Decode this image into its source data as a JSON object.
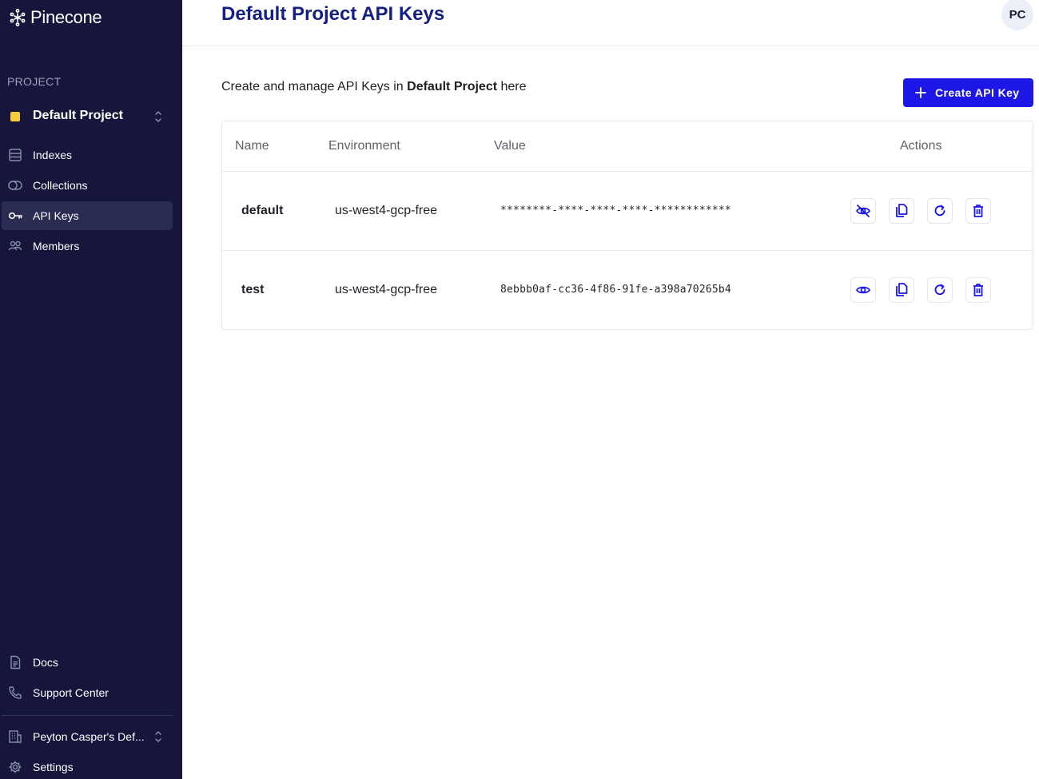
{
  "app": {
    "brand": "Pinecone",
    "brand_icon": "pinecone-logo-icon"
  },
  "sidebar": {
    "section_label": "PROJECT",
    "project": {
      "name": "Default Project",
      "color": "#f5cd3b"
    },
    "nav": [
      {
        "label": "Indexes",
        "icon": "indexes-icon",
        "active": false
      },
      {
        "label": "Collections",
        "icon": "collections-icon",
        "active": false
      },
      {
        "label": "API Keys",
        "icon": "key-icon",
        "active": true
      },
      {
        "label": "Members",
        "icon": "members-icon",
        "active": false
      }
    ],
    "footer": [
      {
        "label": "Docs",
        "icon": "document-icon"
      },
      {
        "label": "Support Center",
        "icon": "phone-icon"
      }
    ],
    "organization": {
      "label": "Peyton Casper's Def...",
      "icon": "building-icon"
    },
    "settings": {
      "label": "Settings",
      "icon": "gear-icon"
    }
  },
  "header": {
    "title": "Default Project API Keys",
    "avatar_initials": "PC"
  },
  "main": {
    "intro_prefix": "Create and manage API Keys in ",
    "intro_project": "Default Project",
    "intro_suffix": " here",
    "create_button": "Create API Key"
  },
  "table": {
    "columns": [
      "Name",
      "Environment",
      "Value",
      "Actions"
    ],
    "rows": [
      {
        "name": "default",
        "environment": "us-west4-gcp-free",
        "value": "********-****-****-****-************",
        "visibility_icon": "eye-off-icon"
      },
      {
        "name": "test",
        "environment": "us-west4-gcp-free",
        "value": "8ebbb0af-cc36-4f86-91fe-a398a70265b4",
        "visibility_icon": "eye-icon"
      }
    ]
  },
  "colors": {
    "sidebar_bg": "#16163d",
    "accent": "#1c17e6",
    "title": "#142182",
    "icon_blue": "#1c17e6"
  }
}
